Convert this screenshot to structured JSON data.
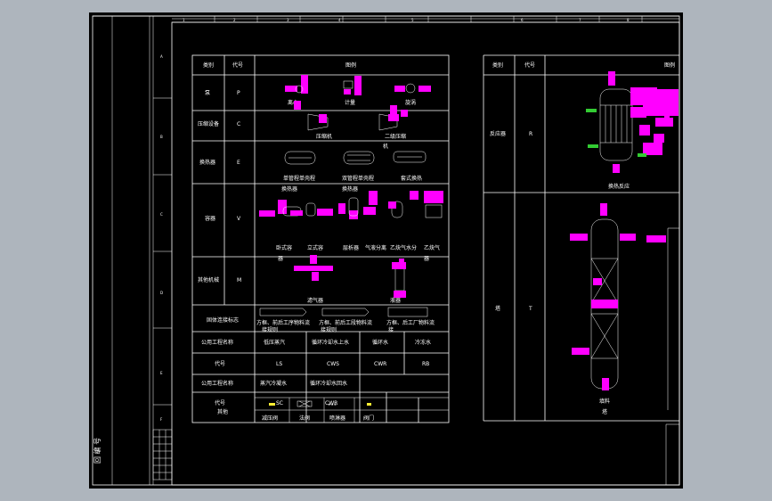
{
  "colors": {
    "background": "#aeb5bd",
    "paper": "#000000",
    "line": "#ffffff",
    "grip": "#ff00ff",
    "nozzle": "#33cc33",
    "symbol": "#ffee33"
  },
  "border": {
    "top_zones": [
      "1",
      "2",
      "3",
      "4",
      "5",
      "6",
      "7",
      "8"
    ],
    "left_zones": [
      "A",
      "B",
      "C",
      "D",
      "E",
      "F"
    ],
    "left_stamp": "回 编 号"
  },
  "table_left": {
    "header": {
      "category": "类别",
      "code": "代号",
      "legend": "图例"
    },
    "rows": [
      {
        "category": "泵",
        "code": "P",
        "items": [
          "离心",
          "计量",
          "旋涡"
        ]
      },
      {
        "category": "压缩设备",
        "code": "C",
        "items": [
          "压缩机",
          "二级压缩",
          "机"
        ]
      },
      {
        "category": "换热器",
        "code": "E",
        "items": [
          "单管程单壳程",
          "双管程单壳程",
          "套式换热",
          "换热器",
          "换热器"
        ]
      },
      {
        "category": "容器",
        "code": "V",
        "items": [
          "卧式容",
          "立式容",
          "器",
          "器",
          "层析器",
          "气液分离",
          "乙炔气水分",
          "乙炔气",
          "器"
        ]
      },
      {
        "category": "其他机械",
        "code": "M",
        "items": [
          "滤气器",
          "液器"
        ]
      },
      {
        "category": "固体连接标志",
        "code": "",
        "items": [
          "方框、前后工序物料流",
          "接规则",
          "方框、前后工段物料流",
          "接规则",
          "方框、后工厂物料流",
          "接"
        ]
      }
    ],
    "utilities": [
      {
        "label": "公用工程名称",
        "values": [
          "低压蒸汽",
          "循环冷却水上水",
          "循环水",
          "冷冻水"
        ]
      },
      {
        "label": "代号",
        "values": [
          "LS",
          "CWS",
          "CWR",
          "RB"
        ]
      },
      {
        "label": "公用工程名称",
        "values": [
          "蒸汽冷凝水",
          "循环冷却水回水",
          "",
          ""
        ]
      },
      {
        "label": "代号",
        "values": [
          "SC",
          "CWR",
          "",
          ""
        ]
      }
    ],
    "others": {
      "label": "其他",
      "items": [
        "减压阀",
        "法阀",
        "喷淋器",
        "阀门"
      ]
    }
  },
  "table_right": {
    "header": {
      "category": "类别",
      "code": "代号",
      "legend": "图例"
    },
    "rows": [
      {
        "category": "反应器",
        "code": "R",
        "items": [
          "换热反应"
        ]
      },
      {
        "category": "塔",
        "code": "T",
        "items": [
          "填料",
          "塔"
        ]
      }
    ]
  }
}
